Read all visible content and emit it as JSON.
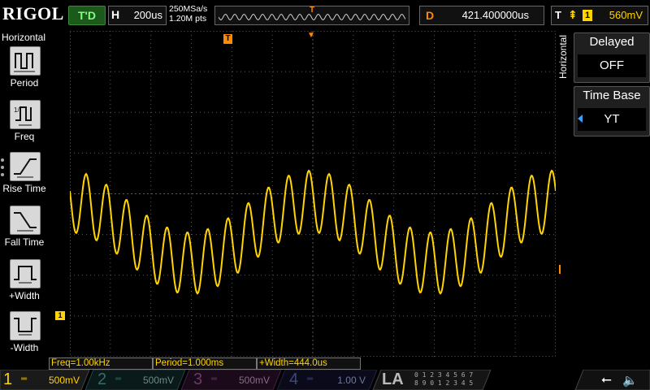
{
  "brand": "RIGOL",
  "status": "T'D",
  "horizontal": {
    "key": "H",
    "value": "200us"
  },
  "sampling": {
    "rate": "250MSa/s",
    "points": "1.20M pts"
  },
  "memory_trigger_symbol": "T",
  "delay": {
    "key": "D",
    "value": "421.400000us"
  },
  "trigger": {
    "key": "T",
    "edge_symbol": "⇞",
    "source": "1",
    "level": "560mV"
  },
  "left_menu": {
    "title": "Horizontal",
    "items": [
      {
        "label": "Period",
        "icon": "period-icon"
      },
      {
        "label": "Freq",
        "icon": "freq-icon"
      },
      {
        "label": "Rise Time",
        "icon": "rise-time-icon"
      },
      {
        "label": "Fall Time",
        "icon": "fall-time-icon"
      },
      {
        "label": "+Width",
        "icon": "positive-width-icon"
      },
      {
        "label": "-Width",
        "icon": "negative-width-icon"
      }
    ]
  },
  "right_menu": {
    "title": "Horizontal",
    "delayed": {
      "label": "Delayed",
      "value": "OFF"
    },
    "time_base": {
      "label": "Time Base",
      "value": "YT"
    }
  },
  "markers": {
    "trigger_position": "T",
    "ch1": "1",
    "trigger_level": "T"
  },
  "measurements": [
    "Freq=1.00kHz",
    "Period=1.000ms",
    "+Width=444.0us"
  ],
  "channels": [
    {
      "num": "1",
      "coupling": "═",
      "scale": "500mV",
      "color": "#ffd400",
      "active": true
    },
    {
      "num": "2",
      "coupling": "═",
      "scale": "500mV",
      "color": "#00c0c0",
      "active": false
    },
    {
      "num": "3",
      "coupling": "═",
      "scale": "500mV",
      "color": "#e040e0",
      "active": false
    },
    {
      "num": "4",
      "coupling": "═",
      "scale": "1.00 V",
      "color": "#3a7fff",
      "active": false
    }
  ],
  "la": {
    "label": "LA",
    "row1": "0 1 2 3  4 5 6 7",
    "row2": "8 9 0 1  2 3 4 5"
  },
  "colors": {
    "trace": "#ffd400",
    "trigger": "#ff8a00",
    "grid": "#5a5a5a"
  }
}
